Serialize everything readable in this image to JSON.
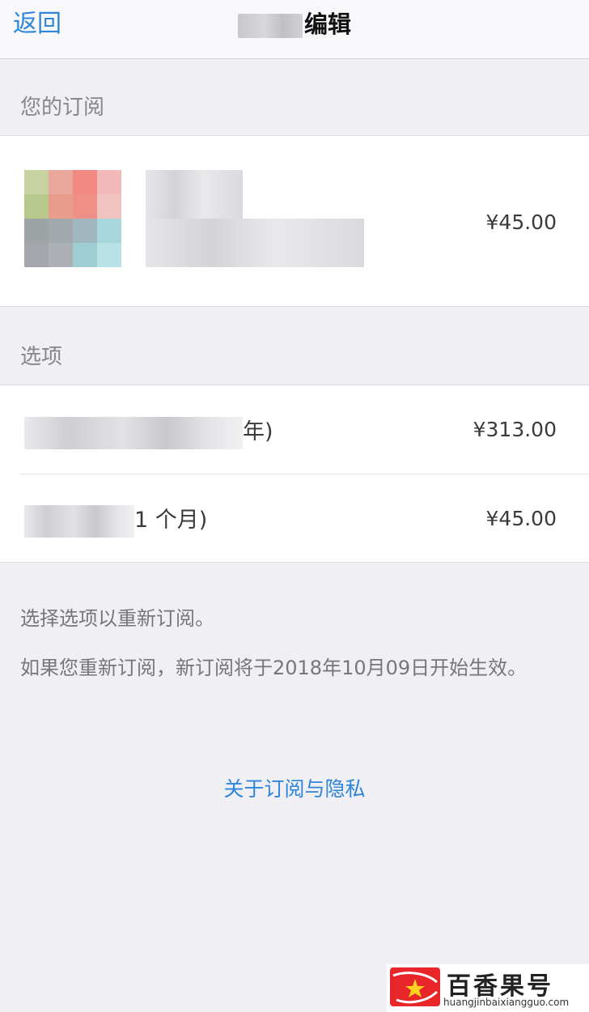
{
  "nav": {
    "back_label": "返回",
    "title_visible": "编辑"
  },
  "subscription_section": {
    "header": "您的订阅",
    "current_price": "¥45.00"
  },
  "options_section": {
    "header": "选项",
    "options": [
      {
        "label_visible": "年)",
        "price": "¥313.00"
      },
      {
        "label_visible": "1 个月)",
        "price": "¥45.00"
      }
    ]
  },
  "footer": {
    "resubscribe_hint": "选择选项以重新订阅。",
    "effective_notice": "如果您重新订阅，新订阅将于2018年10月09日开始生效。",
    "privacy_link": "关于订阅与隐私"
  },
  "watermark": {
    "brand": "百香果号",
    "url": "huangjinbaixiangguo.com"
  },
  "colors": {
    "accent": "#2f86d9",
    "background": "#efeff4",
    "watermark_red": "#e8262a"
  }
}
